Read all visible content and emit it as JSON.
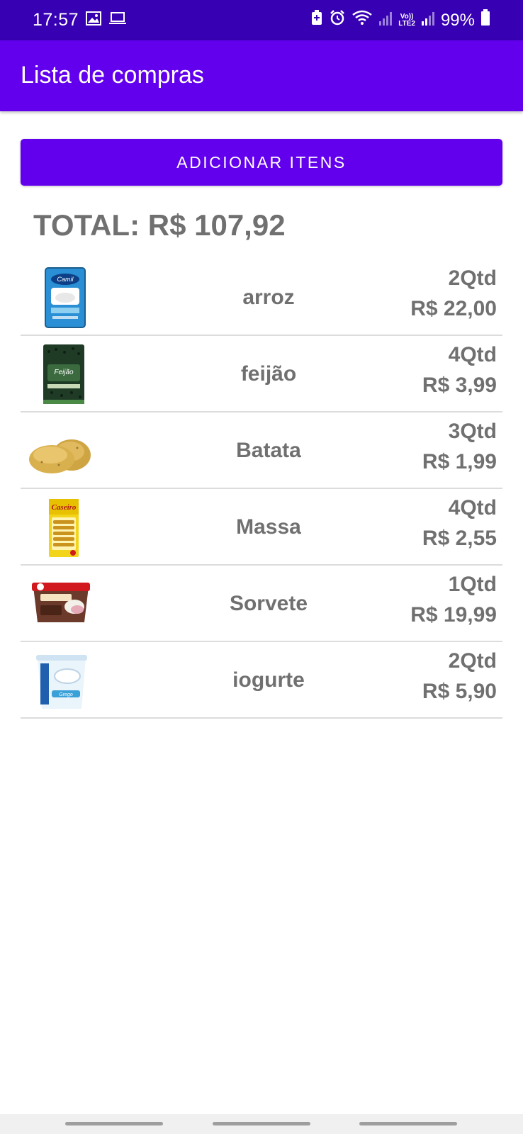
{
  "status_bar": {
    "time": "17:57",
    "network_label": "Vo))\nLTE2",
    "battery": "99%"
  },
  "app_bar": {
    "title": "Lista de compras"
  },
  "actions": {
    "add_label": "ADICIONAR ITENS"
  },
  "summary": {
    "total": "TOTAL: R$ 107,92"
  },
  "items": [
    {
      "name": "arroz",
      "qty": "2Qtd",
      "price": "R$ 22,00",
      "icon": "rice-package-image"
    },
    {
      "name": "feijão",
      "qty": "4Qtd",
      "price": "R$ 3,99",
      "icon": "beans-package-image"
    },
    {
      "name": "Batata",
      "qty": "3Qtd",
      "price": "R$ 1,99",
      "icon": "potato-image"
    },
    {
      "name": "Massa",
      "qty": "4Qtd",
      "price": "R$ 2,55",
      "icon": "pasta-package-image"
    },
    {
      "name": "Sorvete",
      "qty": "1Qtd",
      "price": "R$ 19,99",
      "icon": "ice-cream-box-image"
    },
    {
      "name": "iogurte",
      "qty": "2Qtd",
      "price": "R$ 5,90",
      "icon": "yogurt-cup-image"
    }
  ],
  "colors": {
    "status_bar": "#3700b3",
    "primary": "#6200ee",
    "text_gray": "#707070",
    "divider": "#dcdcdc"
  }
}
